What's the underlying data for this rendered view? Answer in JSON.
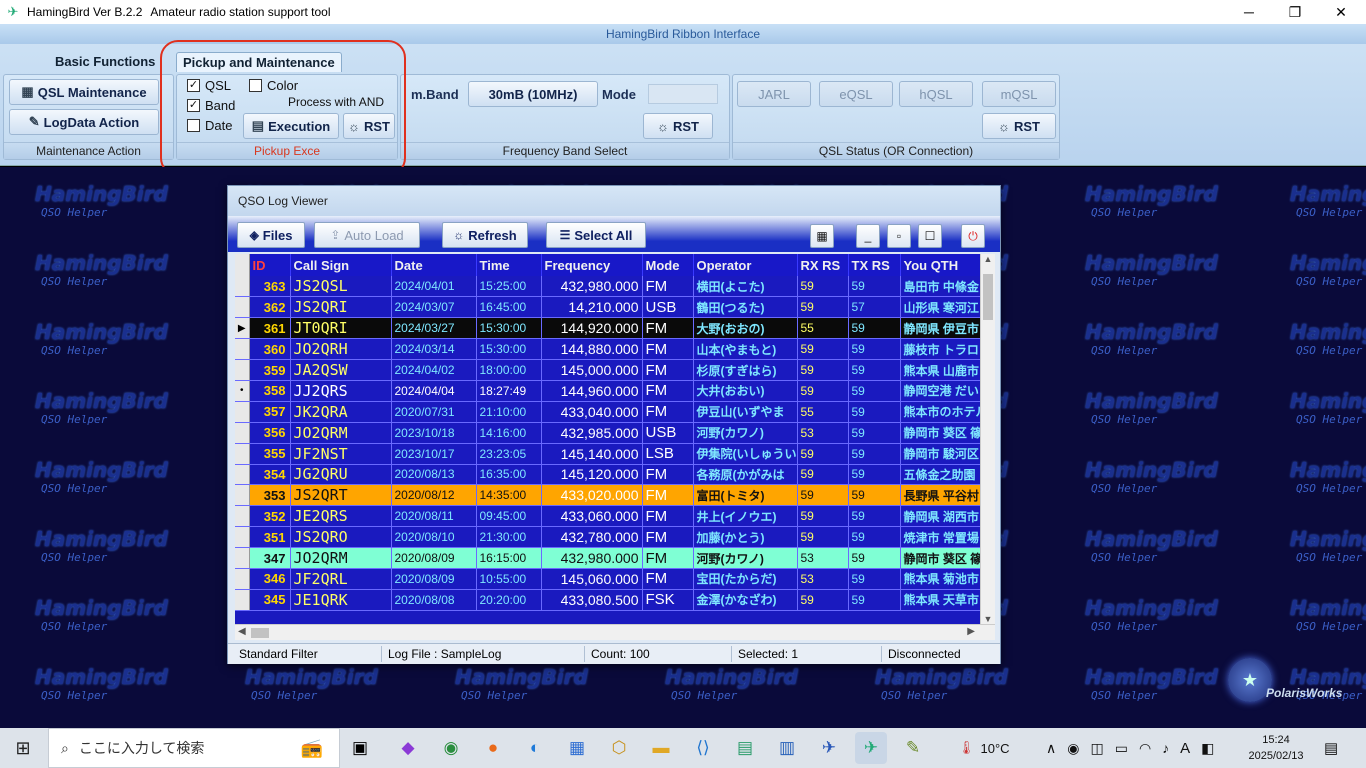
{
  "window": {
    "title": "HamingBird Ver B.2.2",
    "subtitle": "Amateur radio station support tool",
    "controls": [
      "─",
      "❐",
      "✕"
    ]
  },
  "ribbon": {
    "header": "HamingBird Ribbon Interface",
    "tabs": [
      "Basic Functions",
      "Pickup and Maintenance"
    ],
    "maintenance": {
      "qsl_button": "QSL Maintenance",
      "logdata_button": "LogData Action",
      "caption": "Maintenance Action"
    },
    "pickup": {
      "qsl": "QSL",
      "band": "Band",
      "date": "Date",
      "color": "Color",
      "process_note": "Process with AND",
      "execution": "Execution",
      "rst": "RST",
      "caption": "Pickup Exce",
      "qsl_checked": true,
      "band_checked": true,
      "date_checked": false,
      "color_checked": false
    },
    "band": {
      "mband_label": "m.Band",
      "band_value": "30mB (10MHz)",
      "mode_label": "Mode",
      "rst": "RST",
      "caption": "Frequency Band Select"
    },
    "qsl_status": {
      "buttons": [
        "JARL",
        "eQSL",
        "hQSL",
        "mQSL"
      ],
      "rst": "RST",
      "caption": "QSL Status (OR Connection)"
    }
  },
  "watermark": {
    "brand": "HamingBird",
    "tagline": "QSO Helper",
    "corner_logo": "PolarisWorks"
  },
  "viewer": {
    "title": "QSO Log Viewer",
    "toolbar": {
      "files": "Files",
      "auto_load": "Auto Load",
      "refresh": "Refresh",
      "select_all": "Select All"
    },
    "columns": [
      "ID",
      "Call Sign",
      "Date",
      "Time",
      "Frequency",
      "Mode",
      "Operator",
      "RX RS",
      "TX RS",
      "You QTH"
    ],
    "rows": [
      {
        "id": "363",
        "call": "JS2QSL",
        "date": "2024/04/01",
        "time": "15:25:00",
        "freq": "432,980.000",
        "mode": "FM",
        "op": "横田(よこた)",
        "rx": "59",
        "tx": "59",
        "qth": "島田市 中條金",
        "style": ""
      },
      {
        "id": "362",
        "call": "JS2QRI",
        "date": "2024/03/07",
        "time": "16:45:00",
        "freq": "14,210.000",
        "mode": "USB",
        "op": "鶴田(つるた)",
        "rx": "59",
        "tx": "57",
        "qth": "山形県 寒河江",
        "style": ""
      },
      {
        "id": "361",
        "call": "JT0QRI",
        "date": "2024/03/27",
        "time": "15:30:00",
        "freq": "144,920.000",
        "mode": "FM",
        "op": "大野(おおの)",
        "rx": "55",
        "tx": "59",
        "qth": "静岡県 伊豆市",
        "style": "row-black",
        "marker": "▶"
      },
      {
        "id": "360",
        "call": "JO2QRH",
        "date": "2024/03/14",
        "time": "15:30:00",
        "freq": "144,880.000",
        "mode": "FM",
        "op": "山本(やまもと)",
        "rx": "59",
        "tx": "59",
        "qth": "藤枝市 トラロ",
        "style": ""
      },
      {
        "id": "359",
        "call": "JA2QSW",
        "date": "2024/04/02",
        "time": "18:00:00",
        "freq": "145,000.000",
        "mode": "FM",
        "op": "杉原(すぎはら)",
        "rx": "59",
        "tx": "59",
        "qth": "熊本県 山鹿市",
        "style": ""
      },
      {
        "id": "358",
        "call": "JJ2QRS",
        "date": "2024/04/04",
        "time": "18:27:49",
        "freq": "144,960.000",
        "mode": "FM",
        "op": "大井(おおい)",
        "rx": "59",
        "tx": "59",
        "qth": "静岡空港 だい",
        "style": "row-white-text",
        "marker": "•"
      },
      {
        "id": "357",
        "call": "JK2QRA",
        "date": "2020/07/31",
        "time": "21:10:00",
        "freq": "433,040.000",
        "mode": "FM",
        "op": "伊豆山(いずやま",
        "rx": "55",
        "tx": "59",
        "qth": "熊本市のホテル",
        "style": ""
      },
      {
        "id": "356",
        "call": "JO2QRM",
        "date": "2023/10/18",
        "time": "14:16:00",
        "freq": "432,985.000",
        "mode": "USB",
        "op": "河野(カワノ)",
        "rx": "53",
        "tx": "59",
        "qth": "静岡市 葵区 篠",
        "style": ""
      },
      {
        "id": "355",
        "call": "JF2NST",
        "date": "2023/10/17",
        "time": "23:23:05",
        "freq": "145,140.000",
        "mode": "LSB",
        "op": "伊集院(いしゅうい",
        "rx": "59",
        "tx": "59",
        "qth": "静岡市 駿河区",
        "style": ""
      },
      {
        "id": "354",
        "call": "JG2QRU",
        "date": "2020/08/13",
        "time": "16:35:00",
        "freq": "145,120.000",
        "mode": "FM",
        "op": "各務原(かがみは",
        "rx": "59",
        "tx": "59",
        "qth": "五條金之助園",
        "style": ""
      },
      {
        "id": "353",
        "call": "JS2QRT",
        "date": "2020/08/12",
        "time": "14:35:00",
        "freq": "433,020.000",
        "mode": "FM",
        "op": "富田(トミタ)",
        "rx": "59",
        "tx": "59",
        "qth": "長野県 平谷村",
        "style": "row-gold"
      },
      {
        "id": "352",
        "call": "JE2QRS",
        "date": "2020/08/11",
        "time": "09:45:00",
        "freq": "433,060.000",
        "mode": "FM",
        "op": "井上(イノウエ)",
        "rx": "59",
        "tx": "59",
        "qth": "静岡県 湖西市",
        "style": ""
      },
      {
        "id": "351",
        "call": "JS2QRO",
        "date": "2020/08/10",
        "time": "21:30:00",
        "freq": "432,780.000",
        "mode": "FM",
        "op": "加藤(かとう)",
        "rx": "59",
        "tx": "59",
        "qth": "焼津市 常置場",
        "style": ""
      },
      {
        "id": "347",
        "call": "JO2QRM",
        "date": "2020/08/09",
        "time": "16:15:00",
        "freq": "432,980.000",
        "mode": "FM",
        "op": "河野(カワノ)",
        "rx": "53",
        "tx": "59",
        "qth": "静岡市 葵区 篠",
        "style": "row-mint"
      },
      {
        "id": "346",
        "call": "JF2QRL",
        "date": "2020/08/09",
        "time": "10:55:00",
        "freq": "145,060.000",
        "mode": "FM",
        "op": "宝田(たからだ)",
        "rx": "53",
        "tx": "59",
        "qth": "熊本県 菊池市",
        "style": ""
      },
      {
        "id": "345",
        "call": "JE1QRK",
        "date": "2020/08/08",
        "time": "20:20:00",
        "freq": "433,080.500",
        "mode": "FSK",
        "op": "金澤(かなざわ)",
        "rx": "59",
        "tx": "59",
        "qth": "熊本県 天草市",
        "style": ""
      }
    ],
    "status": {
      "filter": "Standard Filter",
      "log_file": "Log File : SampleLog",
      "count": "Count: 100",
      "selected": "Selected: 1",
      "connection": "Disconnected"
    }
  },
  "taskbar": {
    "search_placeholder": "ここに入力して検索",
    "temperature": "10°C",
    "ime": "A",
    "time": "15:24",
    "date": "2025/02/13"
  }
}
